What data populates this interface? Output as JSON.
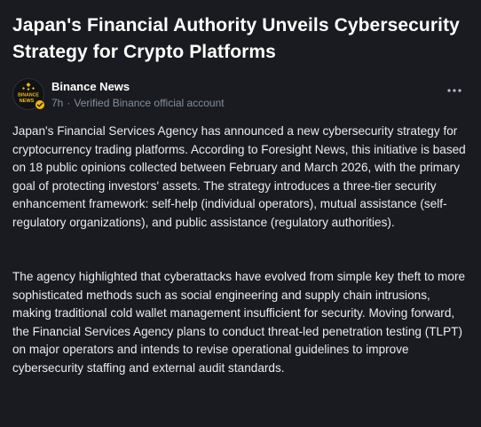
{
  "article": {
    "title": "Japan's Financial Authority Unveils Cybersecurity Strategy for Crypto Platforms",
    "author": {
      "name": "Binance News",
      "avatar_text_top": "BINANCE",
      "avatar_text_bottom": "NEWS",
      "time": "7h",
      "separator": "·",
      "verified_label": "Verified Binance official account"
    },
    "paragraphs": [
      "Japan's Financial Services Agency has announced a new cybersecurity strategy for cryptocurrency trading platforms. According to Foresight News, this initiative is based on 18 public opinions collected between February and March 2026, with the primary goal of protecting investors' assets. The strategy introduces a three-tier security enhancement framework: self-help (individual operators), mutual assistance (self-regulatory organizations), and public assistance (regulatory authorities).",
      "The agency highlighted that cyberattacks have evolved from simple key theft to more sophisticated methods such as social engineering and supply chain intrusions, making traditional cold wallet management insufficient for security. Moving forward, the Financial Services Agency plans to conduct threat-led penetration testing (TLPT) on major operators and intends to revise operational guidelines to improve cybersecurity staffing and external audit standards."
    ]
  },
  "colors": {
    "background": "#1a1b20",
    "title": "#ffffff",
    "body": "#eaecef",
    "muted": "#848e9c",
    "brand_yellow": "#f0b90b"
  },
  "icons": {
    "avatar": "binance-news-logo",
    "verified": "verified-check-icon",
    "more": "more-horizontal-icon"
  }
}
